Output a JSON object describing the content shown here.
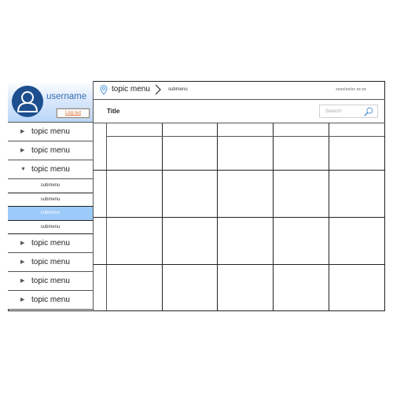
{
  "user": {
    "username": "username",
    "logout_label": "Log out",
    "avatar_icon": "user-avatar-icon"
  },
  "sidebar": {
    "items": [
      {
        "type": "topic",
        "label": "topic menu",
        "icon": "caret-right-icon",
        "expanded": false
      },
      {
        "type": "topic",
        "label": "topic menu",
        "icon": "caret-right-icon",
        "expanded": false
      },
      {
        "type": "topic",
        "label": "topic menu",
        "icon": "caret-down-icon",
        "expanded": true
      },
      {
        "type": "submenu",
        "label": "submenu",
        "active": false
      },
      {
        "type": "submenu",
        "label": "submenu",
        "active": false
      },
      {
        "type": "submenu",
        "label": "submenu",
        "active": true
      },
      {
        "type": "submenu",
        "label": "submenu",
        "active": false
      },
      {
        "type": "topic",
        "label": "topic menu",
        "icon": "caret-right-icon",
        "expanded": false
      },
      {
        "type": "topic",
        "label": "topic menu",
        "icon": "caret-right-icon",
        "expanded": false
      },
      {
        "type": "topic",
        "label": "topic menu",
        "icon": "caret-right-icon",
        "expanded": false
      },
      {
        "type": "topic",
        "label": "topic menu",
        "icon": "caret-right-icon",
        "expanded": false
      }
    ]
  },
  "header": {
    "breadcrumb": {
      "icon": "location-pin-icon",
      "topic": "topic menu",
      "separator_icon": "chevron-right-icon",
      "submenu": "submenu"
    },
    "timestamp": "xxxx/xx/xx xx:xx"
  },
  "content": {
    "title": "Title",
    "search": {
      "placeholder": "Search",
      "value": "",
      "icon": "search-icon"
    },
    "table": {
      "columns": [
        "",
        "",
        "",
        "",
        ""
      ],
      "rows": [
        [
          "",
          "",
          "",
          "",
          ""
        ],
        [
          "",
          "",
          "",
          "",
          ""
        ],
        [
          "",
          "",
          "",
          "",
          ""
        ],
        [
          "",
          "",
          "",
          "",
          ""
        ]
      ]
    }
  },
  "colors": {
    "avatar_bg": "#1d4f8f",
    "username_text": "#3a6fb2",
    "logout_text": "#e07030",
    "active_submenu_bg": "#9ccaf9",
    "pin_icon": "#4a90d9",
    "search_icon": "#4a8fd4"
  }
}
